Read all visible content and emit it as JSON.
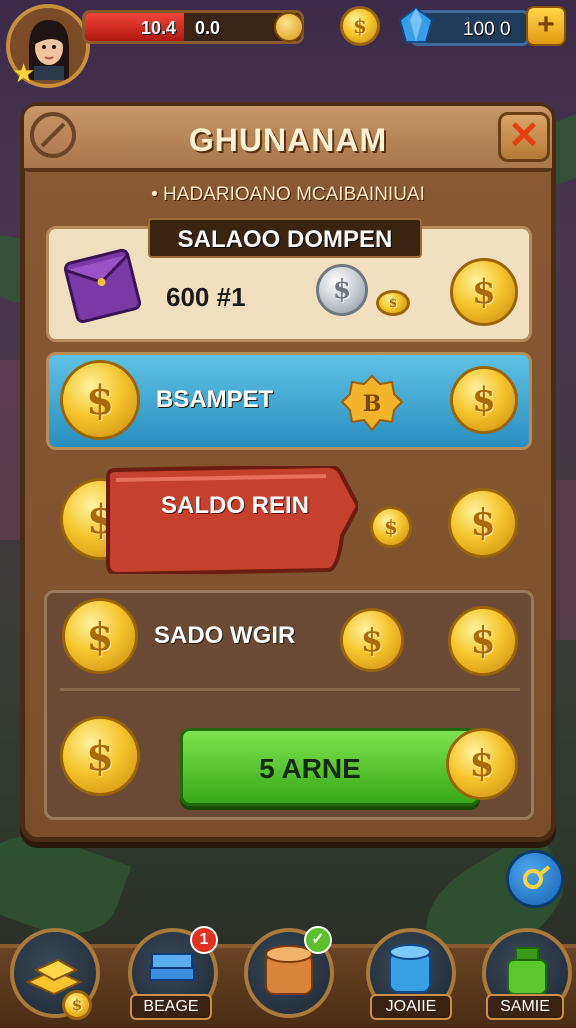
{
  "player": {
    "hp_value": "10.4",
    "hp_secondary": "0.0",
    "gems": "100 0"
  },
  "panel": {
    "title": "GHUNANAM",
    "subtitle": "• HADARIOANO MCAIBAINIUAI",
    "ribbon": "SALAOO DOMPEN",
    "rows": {
      "wallet_amount": "600 #1",
      "blue_label": "BSAMPET",
      "red_button": "SALDO REIN",
      "wager_label": "SADO WGIR",
      "green_button": "5 ARNE"
    }
  },
  "nav": {
    "items": [
      {
        "label": ""
      },
      {
        "label": "BEAGE",
        "badge": "1"
      },
      {
        "label": ""
      },
      {
        "label": "JOAIIE"
      },
      {
        "label": "SAMIE"
      }
    ]
  },
  "coin_symbol": "$",
  "badge_symbol": "B",
  "colors": {
    "panel_wood": "#8a5a34",
    "accent_gold": "#f6c52c",
    "hp_red": "#e0302a",
    "action_green": "#5cc82e",
    "action_red": "#c8402e",
    "blue_row": "#3aa6d6"
  },
  "icons": [
    "avatar",
    "star-icon",
    "coin-icon",
    "gem-icon",
    "plus-icon",
    "close-icon",
    "wallet-icon",
    "badge-icon",
    "key-icon",
    "gold-bars-icon",
    "books-icon",
    "coin-stack-icon",
    "barrel-icon",
    "potion-icon"
  ]
}
